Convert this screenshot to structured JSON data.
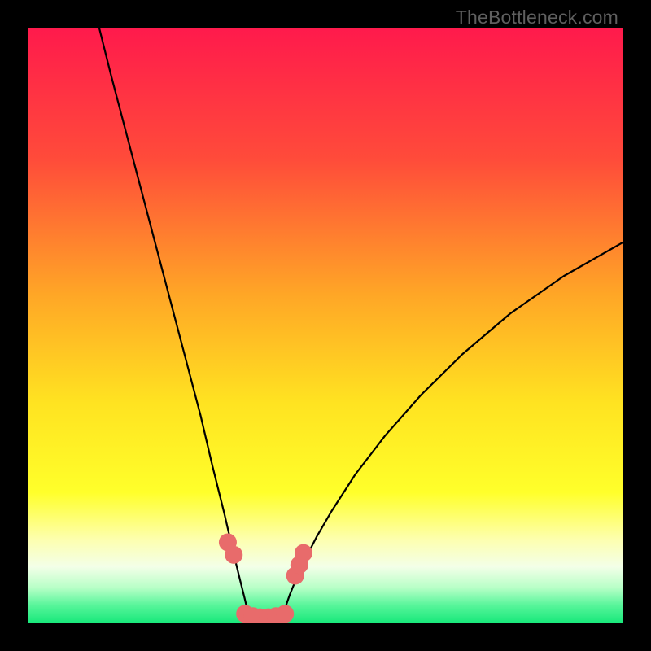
{
  "watermark": "TheBottleneck.com",
  "chart_data": {
    "type": "line",
    "title": "",
    "xlabel": "",
    "ylabel": "",
    "xlim": [
      0,
      100
    ],
    "ylim": [
      0,
      100
    ],
    "background_gradient": {
      "stops": [
        {
          "offset": 0.0,
          "color": "#ff1a4c"
        },
        {
          "offset": 0.22,
          "color": "#ff4b3a"
        },
        {
          "offset": 0.45,
          "color": "#ffa726"
        },
        {
          "offset": 0.63,
          "color": "#ffe321"
        },
        {
          "offset": 0.78,
          "color": "#ffff2a"
        },
        {
          "offset": 0.86,
          "color": "#fdffb0"
        },
        {
          "offset": 0.905,
          "color": "#f3ffe8"
        },
        {
          "offset": 0.94,
          "color": "#b8ffc7"
        },
        {
          "offset": 0.97,
          "color": "#57f59a"
        },
        {
          "offset": 1.0,
          "color": "#17e87a"
        }
      ]
    },
    "series": [
      {
        "name": "bottleneck-curve-left",
        "kind": "line",
        "color": "#000000",
        "width": 2.2,
        "x": [
          12.0,
          14.0,
          16.5,
          19.0,
          21.5,
          24.0,
          26.5,
          29.0,
          31.0,
          33.0,
          34.5,
          35.6,
          36.4,
          36.9,
          37.3
        ],
        "y": [
          100.0,
          92.0,
          82.5,
          73.0,
          63.5,
          54.0,
          44.5,
          35.0,
          26.5,
          18.5,
          12.0,
          7.5,
          4.3,
          2.2,
          0.8
        ]
      },
      {
        "name": "bottleneck-curve-right",
        "kind": "line",
        "color": "#000000",
        "width": 2.2,
        "x": [
          42.7,
          43.2,
          44.0,
          45.1,
          46.6,
          48.5,
          51.0,
          55.0,
          60.0,
          66.0,
          73.0,
          81.0,
          90.0,
          100.0
        ],
        "y": [
          0.8,
          2.5,
          4.8,
          7.5,
          10.8,
          14.5,
          18.8,
          25.0,
          31.5,
          38.3,
          45.2,
          52.0,
          58.3,
          64.0
        ]
      },
      {
        "name": "bottleneck-floor",
        "kind": "line",
        "color": "#000000",
        "width": 2.2,
        "x": [
          37.3,
          38.5,
          40.0,
          41.5,
          42.7
        ],
        "y": [
          0.8,
          0.2,
          0.0,
          0.2,
          0.8
        ]
      },
      {
        "name": "cluster-points",
        "kind": "scatter",
        "color": "#e86b6b",
        "radius": 11,
        "x": [
          33.6,
          34.6,
          36.5,
          37.8,
          39.0,
          40.4,
          41.7,
          43.2,
          44.9,
          45.6,
          46.3
        ],
        "y": [
          13.6,
          11.5,
          1.6,
          1.2,
          1.0,
          1.0,
          1.2,
          1.6,
          8.0,
          9.8,
          11.8
        ]
      }
    ]
  }
}
